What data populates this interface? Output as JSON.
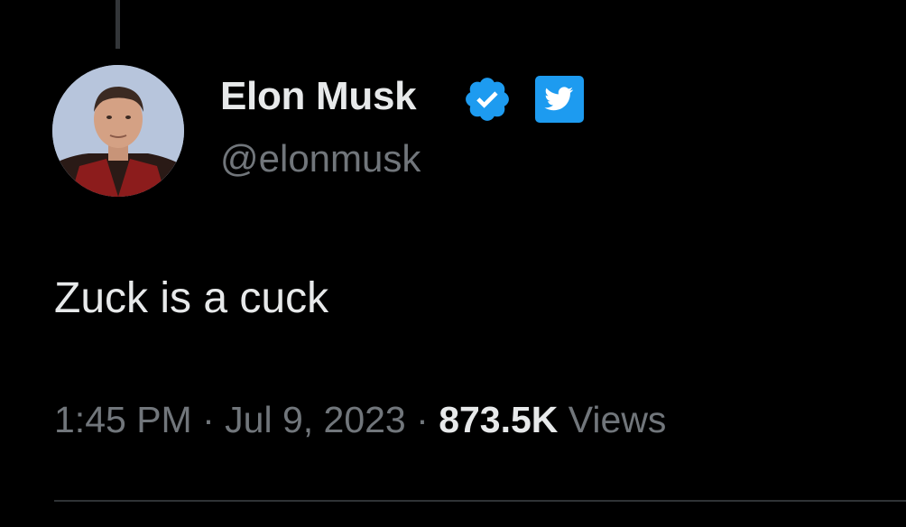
{
  "tweet": {
    "author": {
      "name": "Elon Musk",
      "handle": "@elonmusk",
      "verified_badge_icon": "verified-check-icon",
      "affiliate_badge_icon": "twitter-bird-icon"
    },
    "text": "Zuck is a cuck",
    "meta": {
      "time": "1:45 PM",
      "separator": " · ",
      "date": "Jul 9, 2023",
      "views_count": "873.5K",
      "views_label": " Views"
    }
  },
  "colors": {
    "background": "#000000",
    "primary_text": "#e7e9ea",
    "secondary_text": "#71767b",
    "accent": "#1d9bf0"
  }
}
